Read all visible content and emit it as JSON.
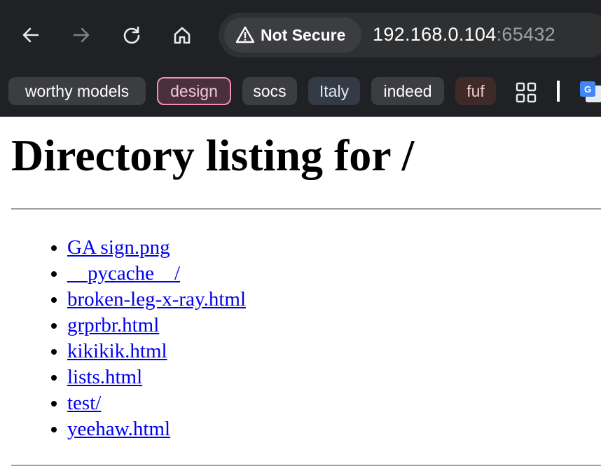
{
  "browser": {
    "security_label": "Not Secure",
    "url_host": "192.168.0.104",
    "url_port": ":65432",
    "bookmarks": [
      {
        "label": "worthy models",
        "bg": "#3c3d40",
        "fg": "#ffffff",
        "border": "none"
      },
      {
        "label": "design",
        "bg": "#4a2f3d",
        "fg": "#f3c6dd",
        "border": "#f48fb1"
      },
      {
        "label": "socs",
        "bg": "#3c3d40",
        "fg": "#ffffff",
        "border": "none"
      },
      {
        "label": "Italy",
        "bg": "#343a46",
        "fg": "#dce6f7",
        "border": "none"
      },
      {
        "label": "indeed",
        "bg": "#3c3d40",
        "fg": "#ffffff",
        "border": "none"
      },
      {
        "label": "fuf",
        "bg": "#3f2a2a",
        "fg": "#f2c9c4",
        "border": "none"
      }
    ],
    "icons": {
      "back": "back-arrow-icon",
      "forward": "forward-arrow-icon",
      "reload": "reload-icon",
      "home": "home-icon",
      "warning": "warning-icon",
      "apps": "apps-grid-icon",
      "translate": "google-translate-icon"
    }
  },
  "page": {
    "heading": "Directory listing for /",
    "entries": [
      "GA sign.png",
      "__pycache__/",
      "broken-leg-x-ray.html",
      "grprbr.html",
      "kikikik.html",
      "lists.html",
      "test/",
      "yeehaw.html"
    ]
  },
  "colors": {
    "chrome_bg": "#202124",
    "link": "#0000ee"
  }
}
